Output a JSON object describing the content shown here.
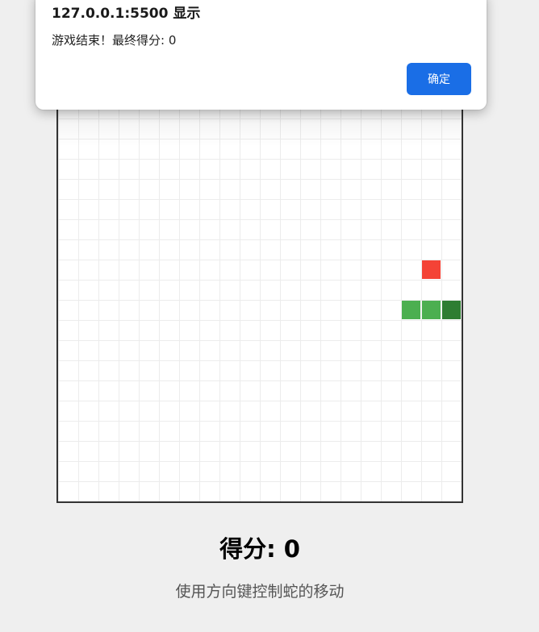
{
  "dialog": {
    "title": "127.0.0.1:5500 显示",
    "message": "游戏结束！最终得分: 0",
    "ok_label": "确定"
  },
  "game": {
    "grid_cells": 20,
    "food": {
      "col": 18,
      "row": 8,
      "color": "#f44336"
    },
    "snake": [
      {
        "col": 19,
        "row": 10,
        "color": "#2e7d32"
      },
      {
        "col": 18,
        "row": 10,
        "color": "#4caf50"
      },
      {
        "col": 17,
        "row": 10,
        "color": "#4caf50"
      }
    ]
  },
  "score_text": "得分: 0",
  "hint_text": "使用方向键控制蛇的移动"
}
